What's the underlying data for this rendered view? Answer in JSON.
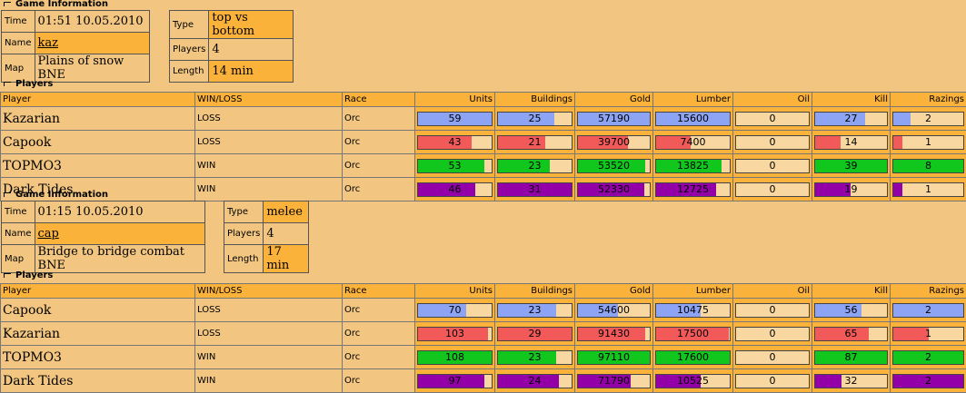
{
  "section_game_title": "Game Information",
  "section_players_title": "Players",
  "labels": {
    "time": "Time",
    "name": "Name",
    "map": "Map",
    "type": "Type",
    "players": "Players",
    "length": "Length"
  },
  "columns": [
    "Player",
    "WIN/LOSS",
    "Race",
    "Units",
    "Buildings",
    "Gold",
    "Lumber",
    "Oil",
    "Kill",
    "Razings"
  ],
  "colors": {
    "blue": "#8da4f4",
    "red": "#f25a5a",
    "green": "#11c61c",
    "purple": "#9400a8",
    "bar_bg": "#f8d8a0",
    "orange": "#fbb23a",
    "tan": "#f2c680"
  },
  "games": [
    {
      "time": "01:51 10.05.2010",
      "name": "kaz",
      "map": "Plains of snow BNE",
      "type": "top vs bottom",
      "players": "4",
      "length": "14 min",
      "rows": [
        {
          "player": "Kazarian",
          "result": "LOSS",
          "race": "Orc",
          "color": "blue",
          "stats": [
            {
              "v": "59",
              "f": 1.0
            },
            {
              "v": "25",
              "f": 0.76
            },
            {
              "v": "57190",
              "f": 1.0
            },
            {
              "v": "15600",
              "f": 1.0
            },
            {
              "v": "0",
              "f": 0
            },
            {
              "v": "27",
              "f": 0.69
            },
            {
              "v": "2",
              "f": 0.25
            }
          ]
        },
        {
          "player": "Capook",
          "result": "LOSS",
          "race": "Orc",
          "color": "red",
          "stats": [
            {
              "v": "43",
              "f": 0.73
            },
            {
              "v": "21",
              "f": 0.64
            },
            {
              "v": "39700",
              "f": 0.69
            },
            {
              "v": "7400",
              "f": 0.47
            },
            {
              "v": "0",
              "f": 0
            },
            {
              "v": "14",
              "f": 0.36
            },
            {
              "v": "1",
              "f": 0.13
            }
          ]
        },
        {
          "player": "TOPMO3",
          "result": "WIN",
          "race": "Orc",
          "color": "green",
          "stats": [
            {
              "v": "53",
              "f": 0.9
            },
            {
              "v": "23",
              "f": 0.7
            },
            {
              "v": "53520",
              "f": 0.94
            },
            {
              "v": "13825",
              "f": 0.89
            },
            {
              "v": "0",
              "f": 0
            },
            {
              "v": "39",
              "f": 1.0
            },
            {
              "v": "8",
              "f": 1.0
            }
          ]
        },
        {
          "player": "Dark Tides",
          "result": "WIN",
          "race": "Orc",
          "color": "purple",
          "stats": [
            {
              "v": "46",
              "f": 0.78
            },
            {
              "v": "31",
              "f": 1.0
            },
            {
              "v": "52330",
              "f": 0.92
            },
            {
              "v": "12725",
              "f": 0.82
            },
            {
              "v": "0",
              "f": 0
            },
            {
              "v": "19",
              "f": 0.49
            },
            {
              "v": "1",
              "f": 0.13
            }
          ]
        }
      ]
    },
    {
      "time": "01:15 10.05.2010",
      "name": "cap",
      "map": "Bridge to bridge combat BNE",
      "type": "melee",
      "players": "4",
      "length": "17 min",
      "rows": [
        {
          "player": "Capook",
          "result": "LOSS",
          "race": "Orc",
          "color": "blue",
          "stats": [
            {
              "v": "70",
              "f": 0.65
            },
            {
              "v": "23",
              "f": 0.79
            },
            {
              "v": "54600",
              "f": 0.56
            },
            {
              "v": "10475",
              "f": 0.6
            },
            {
              "v": "0",
              "f": 0
            },
            {
              "v": "56",
              "f": 0.64
            },
            {
              "v": "2",
              "f": 1.0
            }
          ]
        },
        {
          "player": "Kazarian",
          "result": "LOSS",
          "race": "Orc",
          "color": "red",
          "stats": [
            {
              "v": "103",
              "f": 0.95
            },
            {
              "v": "29",
              "f": 1.0
            },
            {
              "v": "91430",
              "f": 0.94
            },
            {
              "v": "17500",
              "f": 0.99
            },
            {
              "v": "0",
              "f": 0
            },
            {
              "v": "65",
              "f": 0.75
            },
            {
              "v": "1",
              "f": 0.5
            }
          ]
        },
        {
          "player": "TOPMO3",
          "result": "WIN",
          "race": "Orc",
          "color": "green",
          "stats": [
            {
              "v": "108",
              "f": 1.0
            },
            {
              "v": "23",
              "f": 0.79
            },
            {
              "v": "97110",
              "f": 1.0
            },
            {
              "v": "17600",
              "f": 1.0
            },
            {
              "v": "0",
              "f": 0
            },
            {
              "v": "87",
              "f": 1.0
            },
            {
              "v": "2",
              "f": 1.0
            }
          ]
        },
        {
          "player": "Dark Tides",
          "result": "WIN",
          "race": "Orc",
          "color": "purple",
          "stats": [
            {
              "v": "97",
              "f": 0.9
            },
            {
              "v": "24",
              "f": 0.83
            },
            {
              "v": "71790",
              "f": 0.74
            },
            {
              "v": "10525",
              "f": 0.6
            },
            {
              "v": "0",
              "f": 0
            },
            {
              "v": "32",
              "f": 0.37
            },
            {
              "v": "2",
              "f": 1.0
            }
          ]
        }
      ]
    }
  ]
}
